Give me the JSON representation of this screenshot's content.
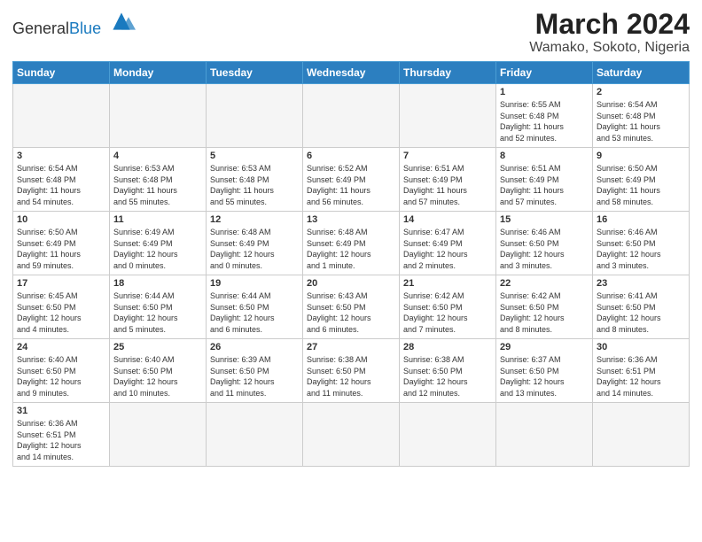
{
  "header": {
    "logo_general": "General",
    "logo_blue": "Blue",
    "title": "March 2024",
    "subtitle": "Wamako, Sokoto, Nigeria"
  },
  "days_of_week": [
    "Sunday",
    "Monday",
    "Tuesday",
    "Wednesday",
    "Thursday",
    "Friday",
    "Saturday"
  ],
  "weeks": [
    [
      {
        "day": "",
        "info": ""
      },
      {
        "day": "",
        "info": ""
      },
      {
        "day": "",
        "info": ""
      },
      {
        "day": "",
        "info": ""
      },
      {
        "day": "",
        "info": ""
      },
      {
        "day": "1",
        "info": "Sunrise: 6:55 AM\nSunset: 6:48 PM\nDaylight: 11 hours\nand 52 minutes."
      },
      {
        "day": "2",
        "info": "Sunrise: 6:54 AM\nSunset: 6:48 PM\nDaylight: 11 hours\nand 53 minutes."
      }
    ],
    [
      {
        "day": "3",
        "info": "Sunrise: 6:54 AM\nSunset: 6:48 PM\nDaylight: 11 hours\nand 54 minutes."
      },
      {
        "day": "4",
        "info": "Sunrise: 6:53 AM\nSunset: 6:48 PM\nDaylight: 11 hours\nand 55 minutes."
      },
      {
        "day": "5",
        "info": "Sunrise: 6:53 AM\nSunset: 6:48 PM\nDaylight: 11 hours\nand 55 minutes."
      },
      {
        "day": "6",
        "info": "Sunrise: 6:52 AM\nSunset: 6:49 PM\nDaylight: 11 hours\nand 56 minutes."
      },
      {
        "day": "7",
        "info": "Sunrise: 6:51 AM\nSunset: 6:49 PM\nDaylight: 11 hours\nand 57 minutes."
      },
      {
        "day": "8",
        "info": "Sunrise: 6:51 AM\nSunset: 6:49 PM\nDaylight: 11 hours\nand 57 minutes."
      },
      {
        "day": "9",
        "info": "Sunrise: 6:50 AM\nSunset: 6:49 PM\nDaylight: 11 hours\nand 58 minutes."
      }
    ],
    [
      {
        "day": "10",
        "info": "Sunrise: 6:50 AM\nSunset: 6:49 PM\nDaylight: 11 hours\nand 59 minutes."
      },
      {
        "day": "11",
        "info": "Sunrise: 6:49 AM\nSunset: 6:49 PM\nDaylight: 12 hours\nand 0 minutes."
      },
      {
        "day": "12",
        "info": "Sunrise: 6:48 AM\nSunset: 6:49 PM\nDaylight: 12 hours\nand 0 minutes."
      },
      {
        "day": "13",
        "info": "Sunrise: 6:48 AM\nSunset: 6:49 PM\nDaylight: 12 hours\nand 1 minute."
      },
      {
        "day": "14",
        "info": "Sunrise: 6:47 AM\nSunset: 6:49 PM\nDaylight: 12 hours\nand 2 minutes."
      },
      {
        "day": "15",
        "info": "Sunrise: 6:46 AM\nSunset: 6:50 PM\nDaylight: 12 hours\nand 3 minutes."
      },
      {
        "day": "16",
        "info": "Sunrise: 6:46 AM\nSunset: 6:50 PM\nDaylight: 12 hours\nand 3 minutes."
      }
    ],
    [
      {
        "day": "17",
        "info": "Sunrise: 6:45 AM\nSunset: 6:50 PM\nDaylight: 12 hours\nand 4 minutes."
      },
      {
        "day": "18",
        "info": "Sunrise: 6:44 AM\nSunset: 6:50 PM\nDaylight: 12 hours\nand 5 minutes."
      },
      {
        "day": "19",
        "info": "Sunrise: 6:44 AM\nSunset: 6:50 PM\nDaylight: 12 hours\nand 6 minutes."
      },
      {
        "day": "20",
        "info": "Sunrise: 6:43 AM\nSunset: 6:50 PM\nDaylight: 12 hours\nand 6 minutes."
      },
      {
        "day": "21",
        "info": "Sunrise: 6:42 AM\nSunset: 6:50 PM\nDaylight: 12 hours\nand 7 minutes."
      },
      {
        "day": "22",
        "info": "Sunrise: 6:42 AM\nSunset: 6:50 PM\nDaylight: 12 hours\nand 8 minutes."
      },
      {
        "day": "23",
        "info": "Sunrise: 6:41 AM\nSunset: 6:50 PM\nDaylight: 12 hours\nand 8 minutes."
      }
    ],
    [
      {
        "day": "24",
        "info": "Sunrise: 6:40 AM\nSunset: 6:50 PM\nDaylight: 12 hours\nand 9 minutes."
      },
      {
        "day": "25",
        "info": "Sunrise: 6:40 AM\nSunset: 6:50 PM\nDaylight: 12 hours\nand 10 minutes."
      },
      {
        "day": "26",
        "info": "Sunrise: 6:39 AM\nSunset: 6:50 PM\nDaylight: 12 hours\nand 11 minutes."
      },
      {
        "day": "27",
        "info": "Sunrise: 6:38 AM\nSunset: 6:50 PM\nDaylight: 12 hours\nand 11 minutes."
      },
      {
        "day": "28",
        "info": "Sunrise: 6:38 AM\nSunset: 6:50 PM\nDaylight: 12 hours\nand 12 minutes."
      },
      {
        "day": "29",
        "info": "Sunrise: 6:37 AM\nSunset: 6:50 PM\nDaylight: 12 hours\nand 13 minutes."
      },
      {
        "day": "30",
        "info": "Sunrise: 6:36 AM\nSunset: 6:51 PM\nDaylight: 12 hours\nand 14 minutes."
      }
    ],
    [
      {
        "day": "31",
        "info": "Sunrise: 6:36 AM\nSunset: 6:51 PM\nDaylight: 12 hours\nand 14 minutes."
      },
      {
        "day": "",
        "info": ""
      },
      {
        "day": "",
        "info": ""
      },
      {
        "day": "",
        "info": ""
      },
      {
        "day": "",
        "info": ""
      },
      {
        "day": "",
        "info": ""
      },
      {
        "day": "",
        "info": ""
      }
    ]
  ]
}
